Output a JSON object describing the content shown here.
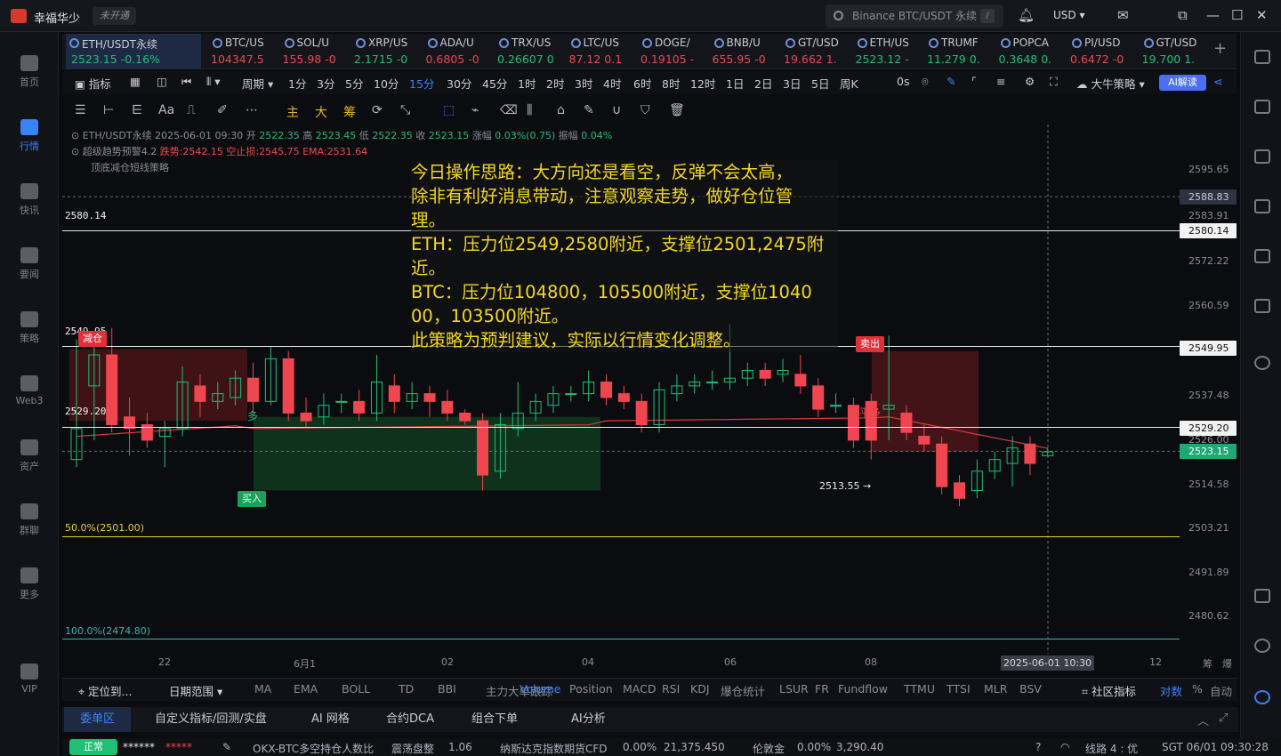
{
  "app": {
    "name": "幸福华少",
    "badge": "未开通",
    "search_placeholder": "Binance BTC/USDT 永续",
    "search_slash": "/",
    "currency": "USD"
  },
  "leftnav": [
    {
      "label": "首页",
      "icon": "home-icon"
    },
    {
      "label": "行情",
      "icon": "chart-bars-icon",
      "active": true
    },
    {
      "label": "快讯",
      "icon": "news-flash-icon"
    },
    {
      "label": "要闻",
      "icon": "headlines-icon"
    },
    {
      "label": "策略",
      "icon": "strategy-robot-icon"
    },
    {
      "label": "Web3",
      "icon": "web3-icon"
    },
    {
      "label": "资产",
      "icon": "wallet-icon"
    },
    {
      "label": "群聊",
      "icon": "chat-icon"
    },
    {
      "label": "更多",
      "icon": "grid-more-icon"
    },
    {
      "label": "VIP",
      "icon": "vip-diamond-icon"
    }
  ],
  "tickers": [
    {
      "name": "ETH/USDT永续",
      "price": "2523.15",
      "change": "-0.16%",
      "dir": "up"
    },
    {
      "name": "BTC/US",
      "price": "104347.5",
      "change": "",
      "dir": "dn"
    },
    {
      "name": "SOL/U",
      "price": "155.98",
      "change": "-0",
      "dir": "dn"
    },
    {
      "name": "XRP/US",
      "price": "2.1715",
      "change": "-0",
      "dir": "up"
    },
    {
      "name": "ADA/U",
      "price": "0.6805",
      "change": "-0",
      "dir": "dn"
    },
    {
      "name": "TRX/US",
      "price": "0.26607",
      "change": "0",
      "dir": "up"
    },
    {
      "name": "LTC/US",
      "price": "87.12",
      "change": "0.1",
      "dir": "dn"
    },
    {
      "name": "DOGE/",
      "price": "0.19105",
      "change": "-",
      "dir": "dn"
    },
    {
      "name": "BNB/U",
      "price": "655.95",
      "change": "-0",
      "dir": "dn"
    },
    {
      "name": "GT/USD",
      "price": "19.662",
      "change": "1.",
      "dir": "dn"
    },
    {
      "name": "ETH/US",
      "price": "2523.12",
      "change": "-",
      "dir": "up"
    },
    {
      "name": "TRUMF",
      "price": "11.279",
      "change": "0.",
      "dir": "up"
    },
    {
      "name": "POPCA",
      "price": "0.3648",
      "change": "0.",
      "dir": "up"
    },
    {
      "name": "PI/USD",
      "price": "0.6472",
      "change": "-0",
      "dir": "dn"
    },
    {
      "name": "GT/USD",
      "price": "19.700",
      "change": "1.",
      "dir": "up"
    }
  ],
  "toolbar": {
    "indicators": "指标",
    "period": "周期",
    "timeframes": [
      "1分",
      "3分",
      "5分",
      "10分",
      "15分",
      "30分",
      "45分",
      "1时",
      "2时",
      "3时",
      "4时",
      "6时",
      "8时",
      "12时",
      "1日",
      "2日",
      "3日",
      "5日",
      "周K"
    ],
    "selected_tf": "15分",
    "countdown": "0s",
    "strategy": "大牛策略",
    "ai": "AI解读"
  },
  "draw_tools": {
    "zhu": "主",
    "da": "大",
    "chou": "筹",
    "font": "Aa"
  },
  "chart_info": {
    "line1_prefix": "ETH/USDT永续 2025-06-01 09:30 开",
    "open": "2522.35",
    "high_label": "高",
    "high": "2523.45",
    "low_label": "低",
    "low": "2522.35",
    "close_label": "收",
    "close": "2523.15",
    "amp_label": "涨幅",
    "amp": "0.03%(0.75)",
    "vol_label": "振幅",
    "vol": "0.04%",
    "line2": "超级趋势预警4.2",
    "drop": "跌势:2542.15",
    "stop": "空止损:2545.75",
    "ema": "EMA:2531.64",
    "line3": "顶底减仓短线策略"
  },
  "note": {
    "lines": [
      "今日操作思路：大方向还是看空，反弹不会太高，",
      "除非有利好消息带动，注意观察走势，做好仓位管",
      "理。",
      "ETH：压力位2549,2580附近，支撑位2501,2475附",
      "近。",
      "BTC：压力位104800，105500附近，支撑位1040",
      "00，103500附近。",
      "此策略为预判建议，实际以行情变化调整。"
    ]
  },
  "levels": {
    "l2580": "2580.14",
    "l2549": "2549.95",
    "l2529": "2529.20",
    "fib50": "50.0%(2501.00)",
    "fib100": "100.0%(2474.80)",
    "low_mark": "2513.55 →"
  },
  "tags": {
    "reduce": "减仓",
    "sell": "卖出",
    "buy": "买入",
    "duo": "多",
    "pingduo": "平多"
  },
  "y_axis": [
    "2595.65",
    "2583.91",
    "2572.22",
    "2560.59",
    "2537.48",
    "2526.00",
    "2514.58",
    "2503.21",
    "2491.89",
    "2480.62"
  ],
  "y_boxes": {
    "crosshair": "2588.83",
    "l2580": "2580.14",
    "l2549": "2549.95",
    "l2529": "2529.20",
    "last": "2523.15"
  },
  "x_axis": [
    "22",
    "6月1",
    "02",
    "04",
    "06",
    "08",
    "12"
  ],
  "x_cursor": "2025-06-01 10:30",
  "x_right": [
    "筹",
    "爆"
  ],
  "indicator_bar": {
    "locate": "定位到...",
    "range": "日期范围",
    "items": [
      "MA",
      "EMA",
      "BOLL",
      "TD",
      "BBI",
      "主力大单跟踪"
    ],
    "sub": [
      "Volume",
      "Position",
      "MACD",
      "RSI",
      "KDJ",
      "爆仓统计",
      "LSUR",
      "FR",
      "Fundflow",
      "TTMU",
      "TTSI",
      "MLR",
      "BSV"
    ],
    "selected": "Volume",
    "community": "社区指标",
    "compare": "对数",
    "pct": "%",
    "auto": "自动"
  },
  "tabs": [
    "委单区",
    "自定义指标/回测/实盘",
    "AI 网格",
    "合约DCA",
    "组合下单",
    "AI分析"
  ],
  "status": {
    "normal": "正常",
    "mask1": "******",
    "mask2": "*****",
    "okx": "OKX-BTC多空持仓人数比",
    "okx_state": "震荡盘整",
    "okx_val": "1.06",
    "nasdaq": "纳斯达克指数期货CFD",
    "nasdaq_pct": "0.00%",
    "nasdaq_val": "21,375.450",
    "gold": "伦敦金",
    "gold_pct": "0.00%",
    "gold_val": "3,290.40",
    "line": "线路 4 : 优",
    "time": "SGT 06/01 09:30:28"
  },
  "chart_data": {
    "type": "candlestick",
    "symbol": "ETH/USDT永续",
    "interval": "15分",
    "ylim": [
      2474.8,
      2600
    ],
    "candles": [
      {
        "o": 2521,
        "c": 2529,
        "h": 2552,
        "l": 2519
      },
      {
        "o": 2540,
        "c": 2548,
        "h": 2551,
        "l": 2526
      },
      {
        "o": 2548,
        "c": 2530,
        "h": 2555,
        "l": 2528
      },
      {
        "o": 2532,
        "c": 2529,
        "h": 2537,
        "l": 2522
      },
      {
        "o": 2530,
        "c": 2526,
        "h": 2533,
        "l": 2524
      },
      {
        "o": 2527,
        "c": 2529,
        "h": 2531,
        "l": 2519
      },
      {
        "o": 2529,
        "c": 2541,
        "h": 2545,
        "l": 2527
      },
      {
        "o": 2540,
        "c": 2536,
        "h": 2543,
        "l": 2532
      },
      {
        "o": 2536,
        "c": 2538,
        "h": 2541,
        "l": 2534
      },
      {
        "o": 2537,
        "c": 2542,
        "h": 2544,
        "l": 2535
      },
      {
        "o": 2542,
        "c": 2536,
        "h": 2546,
        "l": 2533
      },
      {
        "o": 2536,
        "c": 2547,
        "h": 2550,
        "l": 2535
      },
      {
        "o": 2547,
        "c": 2533,
        "h": 2549,
        "l": 2531
      },
      {
        "o": 2533,
        "c": 2531,
        "h": 2537,
        "l": 2529
      },
      {
        "o": 2532,
        "c": 2535,
        "h": 2538,
        "l": 2530
      },
      {
        "o": 2536,
        "c": 2536,
        "h": 2538,
        "l": 2533
      },
      {
        "o": 2536,
        "c": 2533,
        "h": 2539,
        "l": 2531
      },
      {
        "o": 2533,
        "c": 2541,
        "h": 2548,
        "l": 2531
      },
      {
        "o": 2540,
        "c": 2536,
        "h": 2543,
        "l": 2533
      },
      {
        "o": 2536,
        "c": 2538,
        "h": 2541,
        "l": 2534
      },
      {
        "o": 2538,
        "c": 2536,
        "h": 2540,
        "l": 2532
      },
      {
        "o": 2536,
        "c": 2533,
        "h": 2539,
        "l": 2531
      },
      {
        "o": 2533,
        "c": 2531,
        "h": 2534,
        "l": 2530
      },
      {
        "o": 2531,
        "c": 2517,
        "h": 2533,
        "l": 2513
      },
      {
        "o": 2518,
        "c": 2530,
        "h": 2533,
        "l": 2516
      },
      {
        "o": 2529,
        "c": 2533,
        "h": 2541,
        "l": 2527
      },
      {
        "o": 2533,
        "c": 2536,
        "h": 2538,
        "l": 2531
      },
      {
        "o": 2535,
        "c": 2538,
        "h": 2540,
        "l": 2533
      },
      {
        "o": 2538,
        "c": 2538,
        "h": 2540,
        "l": 2536
      },
      {
        "o": 2538,
        "c": 2541,
        "h": 2544,
        "l": 2536
      },
      {
        "o": 2541,
        "c": 2537,
        "h": 2543,
        "l": 2535
      },
      {
        "o": 2538,
        "c": 2536,
        "h": 2540,
        "l": 2534
      },
      {
        "o": 2536,
        "c": 2530,
        "h": 2538,
        "l": 2528
      },
      {
        "o": 2530,
        "c": 2539,
        "h": 2541,
        "l": 2528
      },
      {
        "o": 2538,
        "c": 2540,
        "h": 2543,
        "l": 2536
      },
      {
        "o": 2540,
        "c": 2541,
        "h": 2543,
        "l": 2538
      },
      {
        "o": 2541,
        "c": 2541,
        "h": 2544,
        "l": 2539
      },
      {
        "o": 2541,
        "c": 2542,
        "h": 2556,
        "l": 2539
      },
      {
        "o": 2542,
        "c": 2544,
        "h": 2546,
        "l": 2540
      },
      {
        "o": 2544,
        "c": 2542,
        "h": 2546,
        "l": 2540
      },
      {
        "o": 2543,
        "c": 2544,
        "h": 2547,
        "l": 2541
      },
      {
        "o": 2543,
        "c": 2540,
        "h": 2548,
        "l": 2538
      },
      {
        "o": 2540,
        "c": 2534,
        "h": 2542,
        "l": 2532
      },
      {
        "o": 2535,
        "c": 2535,
        "h": 2538,
        "l": 2533
      },
      {
        "o": 2535,
        "c": 2526,
        "h": 2537,
        "l": 2524
      },
      {
        "o": 2536,
        "c": 2526,
        "h": 2538,
        "l": 2521
      },
      {
        "o": 2534,
        "c": 2535,
        "h": 2553,
        "l": 2526
      },
      {
        "o": 2533,
        "c": 2528,
        "h": 2535,
        "l": 2526
      },
      {
        "o": 2527,
        "c": 2525,
        "h": 2530,
        "l": 2523
      },
      {
        "o": 2525,
        "c": 2514,
        "h": 2527,
        "l": 2512
      },
      {
        "o": 2515,
        "c": 2511,
        "h": 2517,
        "l": 2509
      },
      {
        "o": 2513,
        "c": 2518,
        "h": 2521,
        "l": 2511
      },
      {
        "o": 2518,
        "c": 2521,
        "h": 2523,
        "l": 2516
      },
      {
        "o": 2520,
        "c": 2524,
        "h": 2527,
        "l": 2514
      },
      {
        "o": 2525,
        "c": 2520,
        "h": 2527,
        "l": 2517
      },
      {
        "o": 2522,
        "c": 2523,
        "h": 2524,
        "l": 2522
      }
    ],
    "ema_label": "EMA:2531.64",
    "levels": [
      2580.14,
      2549.95,
      2529.2,
      2501.0,
      2474.8
    ],
    "last": 2523.15
  }
}
